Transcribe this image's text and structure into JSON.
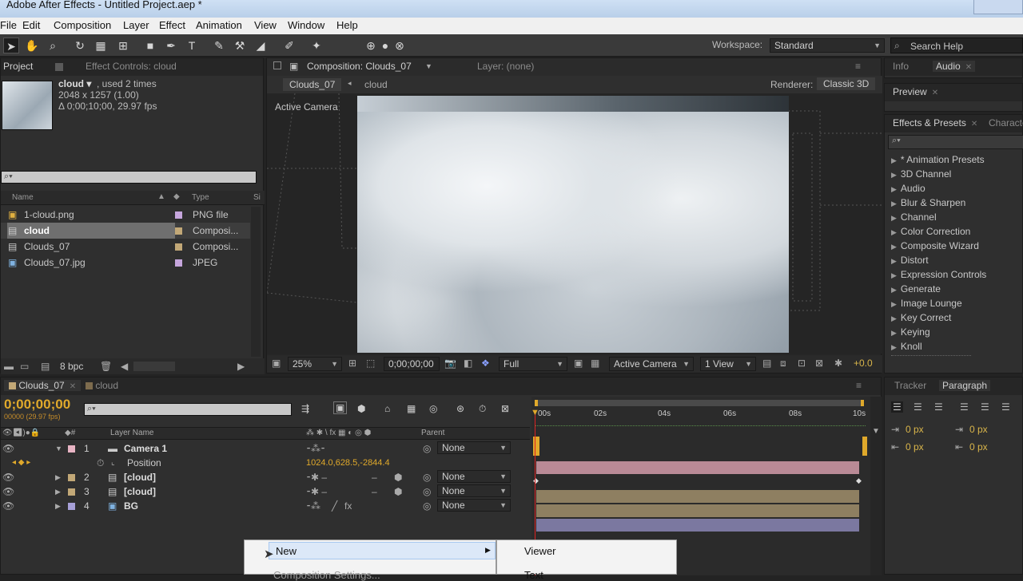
{
  "titlebar": {
    "title": "Adobe After Effects - Untitled Project.aep *"
  },
  "menu": [
    "File",
    "Edit",
    "Composition",
    "Layer",
    "Effect",
    "Animation",
    "View",
    "Window",
    "Help"
  ],
  "toolbar": {
    "workspace_label": "Workspace:",
    "workspace_value": "Standard",
    "search_placeholder": "Search Help"
  },
  "project": {
    "tab_project": "Project",
    "tab_effects": "Effect Controls: cloud",
    "selected_name": "cloud ▾",
    "selected_used": ", used 2 times",
    "selected_dims": "2048 x 1257 (1.00)",
    "selected_duration": "Δ 0;00;10;00, 29.97 fps",
    "search_placeholder": "",
    "col_name": "Name",
    "col_type": "Type",
    "col_size": "Si",
    "items": [
      {
        "name": "1-cloud.png",
        "type": "PNG file",
        "color": "#c6a6dd",
        "icon": "image-icon"
      },
      {
        "name": "cloud",
        "type": "Composi...",
        "color": "#c2a877",
        "icon": "composition-icon"
      },
      {
        "name": "Clouds_07",
        "type": "Composi...",
        "color": "#c2a877",
        "icon": "composition-icon"
      },
      {
        "name": "Clouds_07.jpg",
        "type": "JPEG",
        "color": "#c6a6dd",
        "icon": "image-icon"
      }
    ],
    "bpc": "8 bpc"
  },
  "comp": {
    "tab_comp": "Composition: Clouds_07",
    "tab_layer": "Layer: (none)",
    "crumb1": "Clouds_07",
    "crumb2": "cloud",
    "renderer_label": "Renderer:",
    "renderer_value": "Classic 3D",
    "active_camera": "Active Camera",
    "zoom": "25%",
    "timecode": "0;00;00;00",
    "resolution": "Full",
    "view": "Active Camera",
    "views": "1 View",
    "exposure": "+0.0"
  },
  "right": {
    "tab_info": "Info",
    "tab_audio": "Audio",
    "tab_preview": "Preview",
    "tab_effects": "Effects & Presets",
    "tab_char": "Characte",
    "effects": [
      "* Animation Presets",
      "3D Channel",
      "Audio",
      "Blur & Sharpen",
      "Channel",
      "Color Correction",
      "Composite Wizard",
      "Distort",
      "Expression Controls",
      "Generate",
      "Image Lounge",
      "Key Correct",
      "Keying",
      "Knoll"
    ],
    "tab_tracker": "Tracker",
    "tab_paragraph": "Paragraph",
    "indent1": "0 px",
    "indent2": "0 px",
    "space1": "0 px",
    "space2": "0 px"
  },
  "timeline": {
    "tab1": "Clouds_07",
    "tab2": "cloud",
    "timecode": "0;00;00;00",
    "fps_note": "00000 (29.97 fps)",
    "col_layer": "Layer Name",
    "col_parent": "Parent",
    "ruler": [
      "00s",
      "02s",
      "04s",
      "06s",
      "08s",
      "10s"
    ],
    "layers": [
      {
        "num": "1",
        "name": "Camera 1",
        "parent": "None",
        "color": "#e8b4c4",
        "bar": "#b98a96"
      },
      {
        "num": "2",
        "name": "[cloud]",
        "parent": "None",
        "color": "#c2a877",
        "bar": "#8e7f61"
      },
      {
        "num": "3",
        "name": "[cloud]",
        "parent": "None",
        "color": "#c2a877",
        "bar": "#8e7f61"
      },
      {
        "num": "4",
        "name": "BG",
        "parent": "None",
        "color": "#a7a0d8",
        "bar": "#7b78a0"
      }
    ],
    "position_label": "Position",
    "position_value": "1024.0,628.5,-2844.4"
  },
  "context": {
    "item_new": "New",
    "item_comp": "Composition Settings...",
    "sub_viewer": "Viewer",
    "sub_text": "Text"
  }
}
